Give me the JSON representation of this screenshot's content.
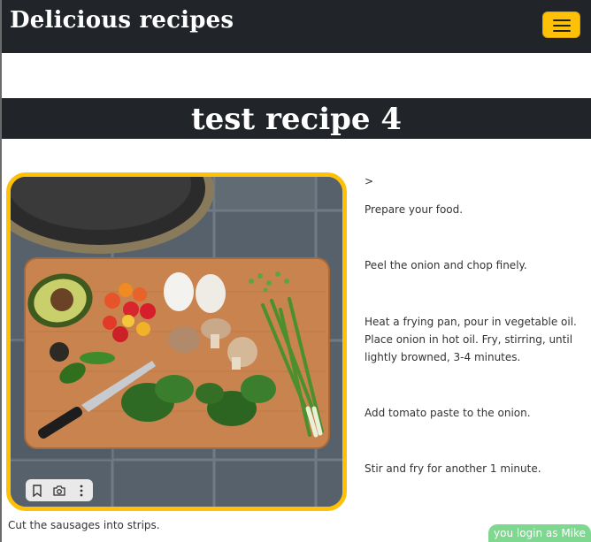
{
  "navbar": {
    "brand": "Delicious recipes",
    "toggler_icon": "hamburger-menu-icon",
    "toggler_color": "#ffc107",
    "background": "#212529"
  },
  "recipe": {
    "title": "test recipe 4",
    "image_alt": "Vegetables on a cutting board",
    "image_toolbar": {
      "icons": [
        "bookmark-icon",
        "camera-icon",
        "more-vertical-icon"
      ]
    },
    "steps": [
      ">",
      "Prepare your food.",
      "Peel the onion and chop finely.",
      "Heat a frying pan, pour in vegetable oil. Place onion in hot oil. Fry, stirring, until lightly browned, 3-4 minutes.",
      "Add tomato paste to the onion.",
      "Stir and fry for another 1 minute."
    ],
    "caption": "Cut the sausages into strips."
  },
  "status": {
    "login_text": "you login as Mike",
    "badge_color": "#7fd88f"
  }
}
